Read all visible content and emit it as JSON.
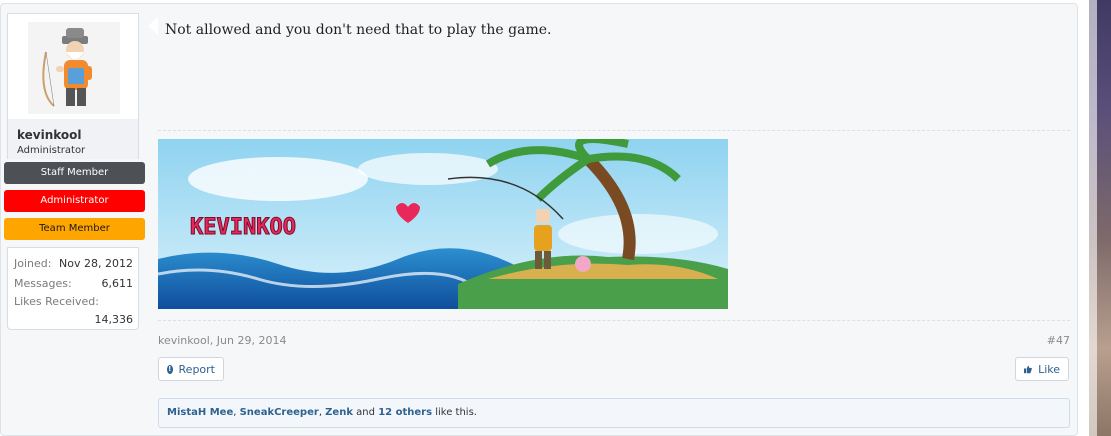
{
  "user": {
    "username": "kevinkool",
    "title": "Administrator",
    "banners": [
      "Staff Member",
      "Administrator",
      "Team Member"
    ],
    "stats": [
      {
        "label": "Joined:",
        "value": "Nov 28, 2012"
      },
      {
        "label": "Messages:",
        "value": "6,611"
      },
      {
        "label": "Likes Received:",
        "value": "14,336"
      }
    ]
  },
  "message": {
    "text": "Not allowed and you don't need that to play the game.",
    "signature_text": "KEVINKOO",
    "author_date": "kevinkool, Jun 29, 2014",
    "post_number": "#47"
  },
  "actions": {
    "report": "Report",
    "like": "Like"
  },
  "likes": {
    "users": [
      "MistaH Mee",
      "SneakCreeper",
      "Zenk"
    ],
    "sep": ", ",
    "and": "and",
    "others": "12 others",
    "suffix": "like this."
  },
  "colors": {
    "staff": "#4d5156",
    "admin": "#ff0000",
    "team": "#ffa500",
    "link": "#2f6190"
  }
}
